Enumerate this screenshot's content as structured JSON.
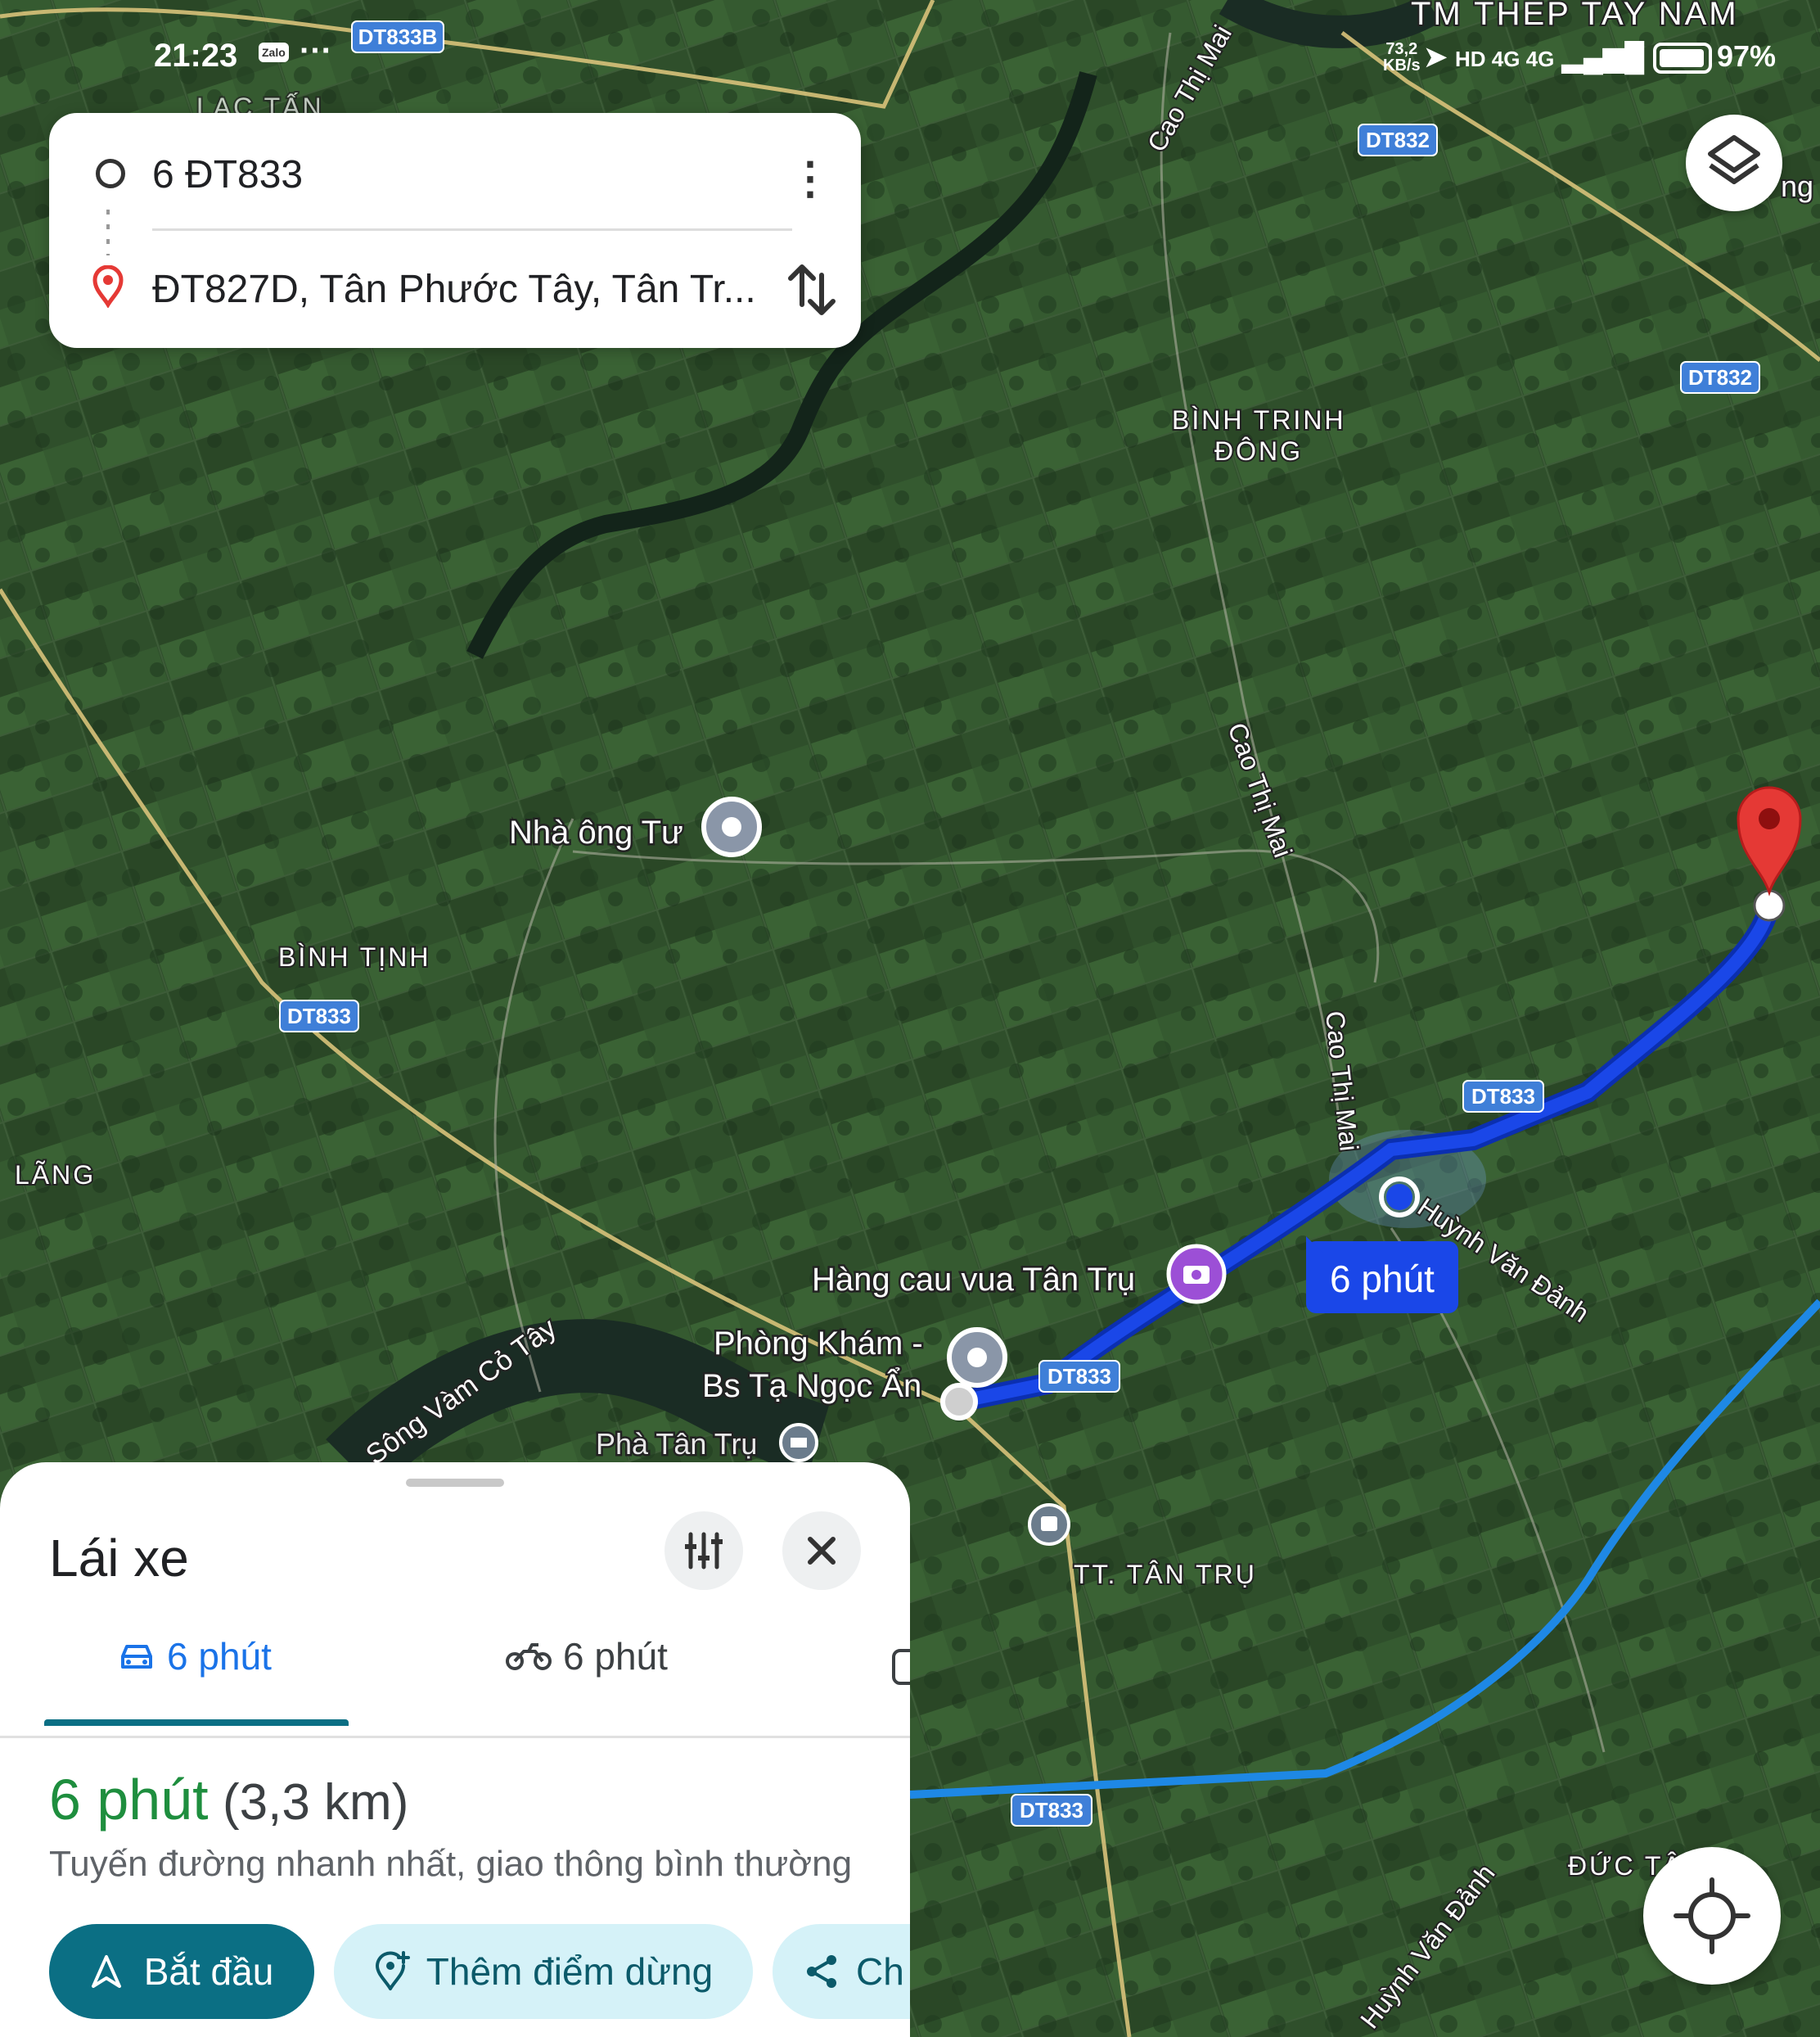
{
  "status_bar": {
    "time": "21:23",
    "app_notification": "Zalo",
    "more": "···",
    "net_speed_value": "73,2",
    "net_speed_unit": "KB/s",
    "network_icons": "HD 4G 4G",
    "battery_percent": 97,
    "battery_text": "97%"
  },
  "search": {
    "origin": "6 ĐT833",
    "destination": "ĐT827D, Tân Phước Tây, Tân Tr...",
    "more_icon": "more-vert-icon",
    "swap_icon": "swap-vertical-icon"
  },
  "map": {
    "area_labels": {
      "top_business": "TM THEP TAY NAM",
      "lac_tan": "LẠC TẤN",
      "binh_trinh_line1": "BÌNH TRINH",
      "binh_trinh_line2": "ĐÔNG",
      "binh_tinh": "BÌNH TỊNH",
      "lang": "LÃNG",
      "tt_tan_tru": "TT. TÂN TRỤ",
      "duc_tan": "ĐỨC TÂ",
      "ng": "ng"
    },
    "road_badges": {
      "dt833b": "DT833B",
      "dt832_top": "DT832",
      "dt832_right": "DT832",
      "dt833_left": "DT833",
      "dt833_route_upper": "DT833",
      "dt833_route_lower": "DT833",
      "dt833_bottom": "DT833"
    },
    "street_labels": {
      "cao_thi_mai_top": "Cao Thị Mai",
      "cao_thi_mai_mid": "Cao Thị Mai",
      "cao_thi_mai_lower": "Cao Thị Mai",
      "huynh_van_danh": "Huỳnh Văn Đảnh",
      "huynh_van_danh_bottom": "Huỳnh Văn Đảnh",
      "song_vam_co_tay": "Sông Vàm Cỏ Tây"
    },
    "places": {
      "nha_ong_tu": "Nhà ông Tư",
      "hang_cau": "Hàng cau vua Tân Trụ",
      "phong_kham_line1": "Phòng Khám -",
      "phong_kham_line2": "Bs Tạ Ngọc Ẩn",
      "pha_tan_tru": "Phà Tân Trụ"
    },
    "duration_bubble": "6 phút",
    "colors": {
      "route": "#1a47e8",
      "route_outline": "#0b2fb0",
      "secondary_route": "#1e88e5",
      "road_yellow": "#d8c27a",
      "satellite": "#2d4a2a",
      "destination_pin": "#e53935"
    }
  },
  "sheet": {
    "title": "Lái xe",
    "settings_icon": "tune-icon",
    "close_icon": "close-icon",
    "tabs": [
      {
        "label": "6 phút",
        "icon": "car-icon",
        "selected": true
      },
      {
        "label": "6 phút",
        "icon": "motorbike-icon",
        "selected": false
      },
      {
        "label": "",
        "icon": "transit-icon",
        "selected": false
      }
    ],
    "duration": "6 phút",
    "distance": "(3,3 km)",
    "route_desc": "Tuyến đường nhanh nhất, giao thông bình thường",
    "start_label": "Bắt đầu",
    "add_stop_label": "Thêm điểm dừng",
    "share_label": "Ch"
  },
  "controls": {
    "layers_icon": "layers-icon",
    "locate_icon": "my-location-icon"
  }
}
